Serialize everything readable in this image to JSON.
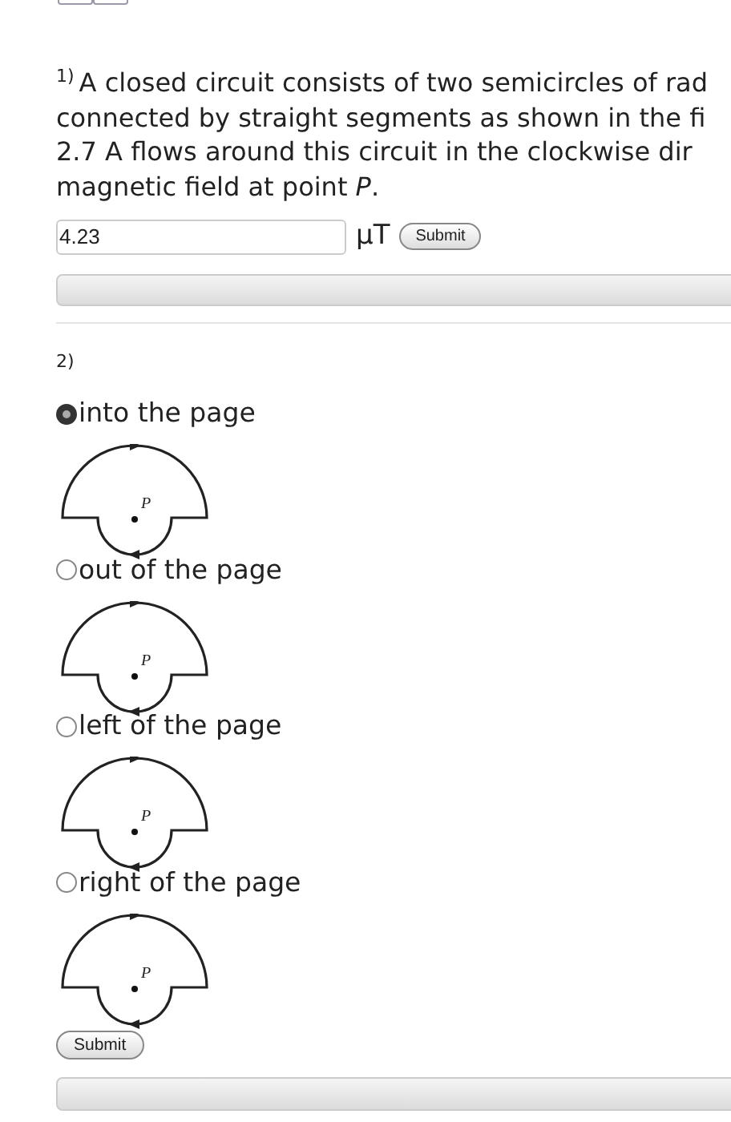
{
  "question_1": {
    "number": "1)",
    "lines": [
      "A closed circuit consists of two semicircles of rad",
      "connected by straight segments as shown in the fi",
      "2.7 A flows around this circuit in the clockwise dir",
      "magnetic field at point *P*."
    ],
    "answer": {
      "value": "4.23"
    },
    "unit": "μT",
    "submit": "Submit"
  },
  "question_2": {
    "number": "2)",
    "options": [
      {
        "label": "into the page",
        "selected": true,
        "point_label": "P"
      },
      {
        "label": "out of the page",
        "selected": false,
        "point_label": "P"
      },
      {
        "label": "left of the page",
        "selected": false,
        "point_label": "P"
      },
      {
        "label": "right of the page",
        "selected": false,
        "point_label": "P"
      }
    ],
    "submit": "Submit"
  }
}
